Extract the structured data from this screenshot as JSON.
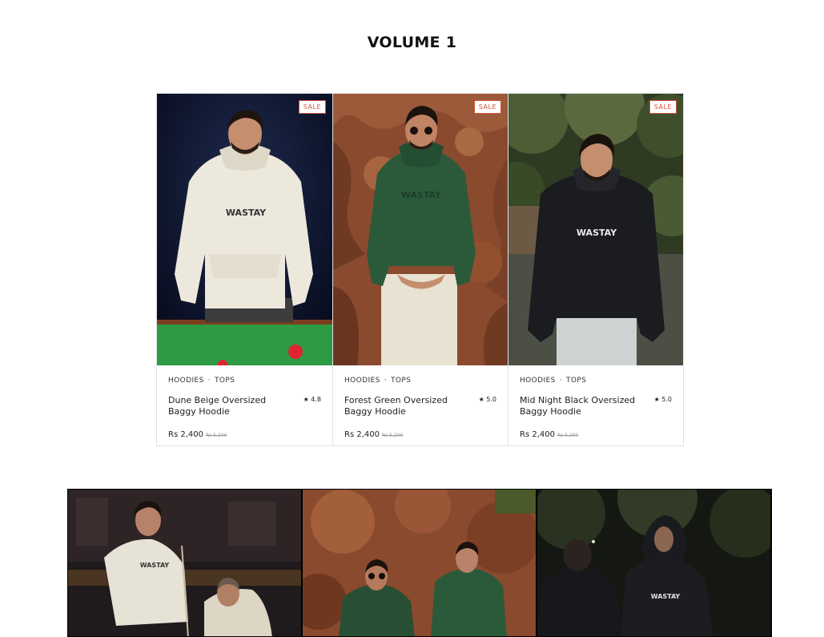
{
  "section": {
    "title": "VOLUME 1"
  },
  "products": [
    {
      "badge": "SALE",
      "cat1": "HOODIES",
      "cat2": "TOPS",
      "sep": "·",
      "title": "Dune Beige Oversized Baggy Hoodie",
      "rating": "★ 4.8",
      "price": "Rs 2,400",
      "old_price": "Rs 5,200",
      "print": "WASTAY"
    },
    {
      "badge": "SALE",
      "cat1": "HOODIES",
      "cat2": "TOPS",
      "sep": "·",
      "title": "Forest Green Oversized Baggy Hoodie",
      "rating": "★ 5.0",
      "price": "Rs 2,400",
      "old_price": "Rs 5,200",
      "print": "WASTAY"
    },
    {
      "badge": "SALE",
      "cat1": "HOODIES",
      "cat2": "TOPS",
      "sep": "·",
      "title": "Mid Night Black Oversized Baggy Hoodie",
      "rating": "★ 5.0",
      "price": "Rs 2,400",
      "old_price": "Rs 5,200",
      "print": "WASTAY"
    }
  ],
  "gallery": [
    {
      "print": "WASTAY"
    },
    {
      "print": ""
    },
    {
      "print": "WASTAY"
    }
  ],
  "colors": {
    "sale": "#d3513e",
    "beige": "#ece8dc",
    "forest_green": "#2b5a3a",
    "midnight_black": "#1a1c20"
  }
}
